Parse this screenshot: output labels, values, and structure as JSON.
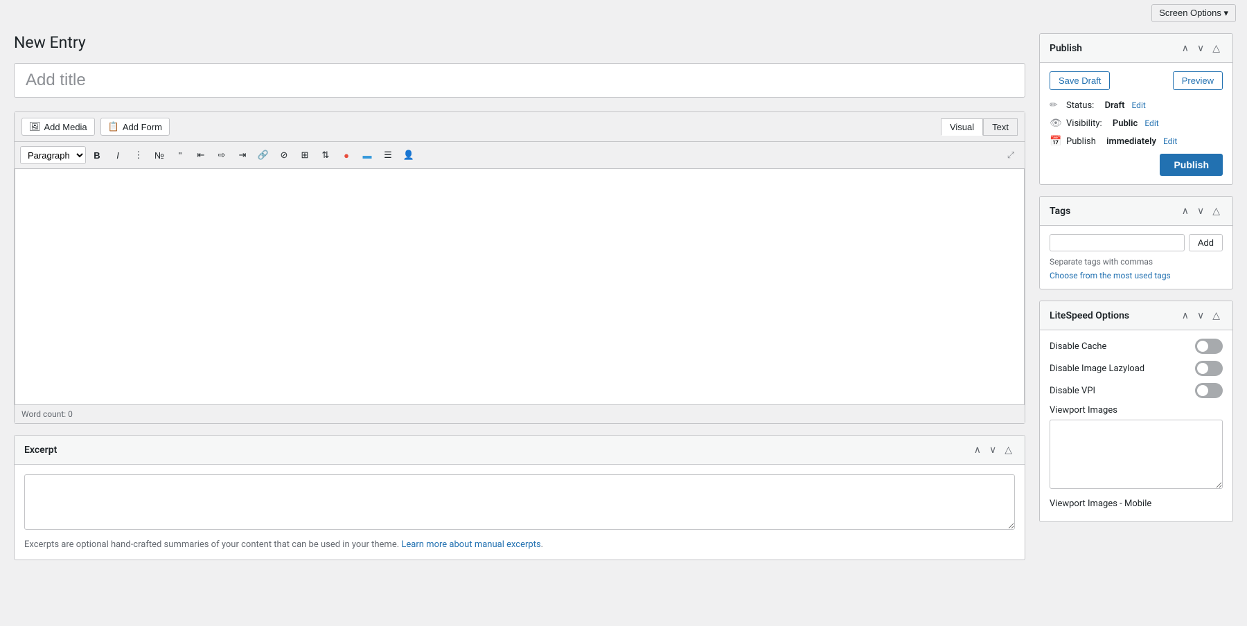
{
  "topBar": {
    "screenOptions": "Screen Options ▾"
  },
  "pageTitle": "New Entry",
  "titleInput": {
    "placeholder": "Add title",
    "value": ""
  },
  "mediaBar": {
    "addMedia": "Add Media",
    "addForm": "Add Form",
    "tabs": {
      "visual": "Visual",
      "text": "Text",
      "activeTab": "visual"
    }
  },
  "toolbar": {
    "paragraph": "Paragraph",
    "bold": "B",
    "italic": "I",
    "bulletList": "≡",
    "numberedList": "≡",
    "blockquote": "❝",
    "alignLeft": "≡",
    "alignCenter": "≡",
    "alignRight": "≡",
    "link": "🔗",
    "unlink": "⊘",
    "fullscreen": "⤢"
  },
  "editor": {
    "content": "",
    "wordCount": "Word count: 0"
  },
  "excerpt": {
    "title": "Excerpt",
    "placeholder": "",
    "note": "Excerpts are optional hand-crafted summaries of your content that can be used in your theme.",
    "learnMoreText": "Learn more about manual excerpts",
    "learnMoreUrl": "#"
  },
  "publish": {
    "title": "Publish",
    "saveDraft": "Save Draft",
    "preview": "Preview",
    "status": {
      "label": "Status:",
      "value": "Draft",
      "editLabel": "Edit"
    },
    "visibility": {
      "label": "Visibility:",
      "value": "Public",
      "editLabel": "Edit"
    },
    "publishTime": {
      "label": "Publish",
      "value": "immediately",
      "editLabel": "Edit"
    },
    "publishBtn": "Publish"
  },
  "tags": {
    "title": "Tags",
    "addBtn": "Add",
    "hint": "Separate tags with commas",
    "chooseLink": "Choose from the most used tags"
  },
  "litespeed": {
    "title": "LiteSpeed Options",
    "disableCache": "Disable Cache",
    "disableImageLazyload": "Disable Image Lazyload",
    "disableVPI": "Disable VPI",
    "viewportImages": "Viewport Images",
    "viewportImagesMobile": "Viewport Images - Mobile"
  }
}
